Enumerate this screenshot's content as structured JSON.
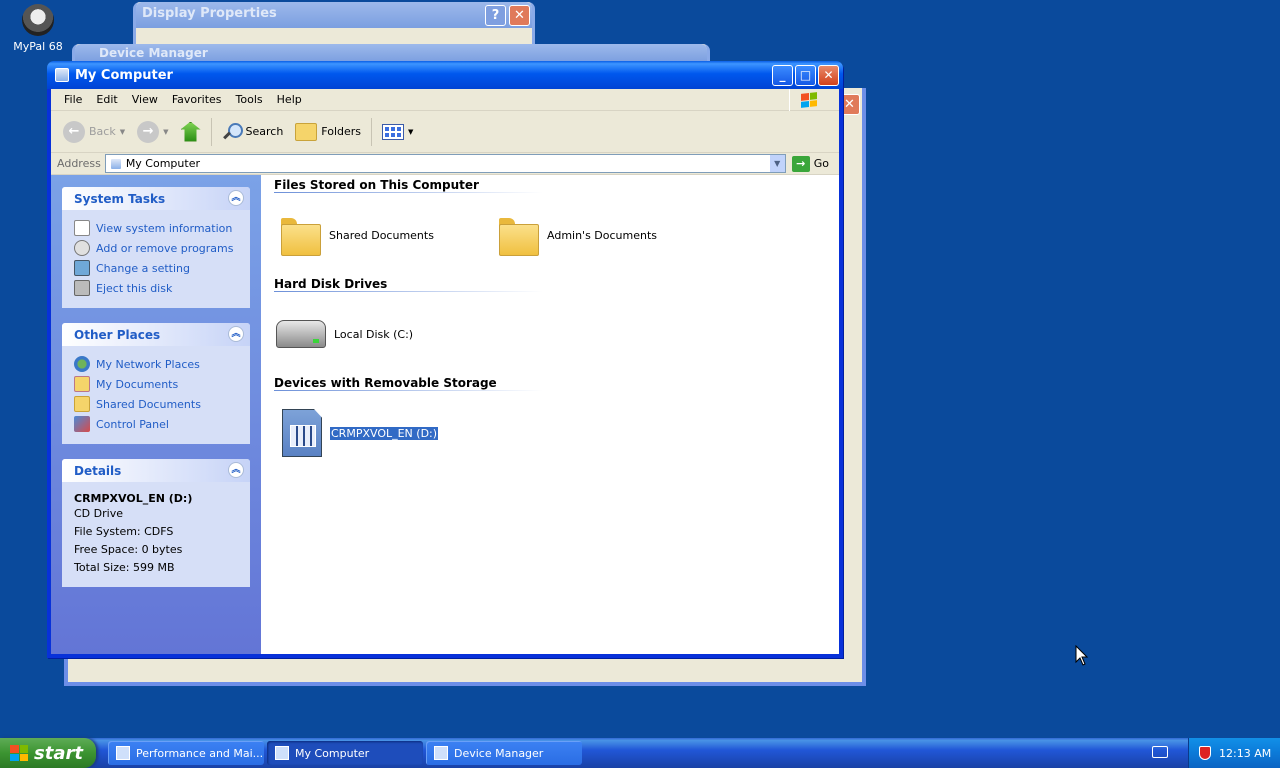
{
  "desktop": {
    "icons": [
      {
        "label": "MyPal 68"
      }
    ]
  },
  "bg_windows": {
    "display_properties": {
      "title": "Display Properties"
    },
    "device_manager": {
      "title": "Device Manager"
    }
  },
  "window": {
    "title": "My Computer",
    "menu": [
      "File",
      "Edit",
      "View",
      "Favorites",
      "Tools",
      "Help"
    ],
    "toolbar": {
      "back": "Back",
      "search": "Search",
      "folders": "Folders"
    },
    "address": {
      "label": "Address",
      "value": "My Computer",
      "go": "Go"
    },
    "left": {
      "system_tasks": {
        "title": "System Tasks",
        "items": [
          "View system information",
          "Add or remove programs",
          "Change a setting",
          "Eject this disk"
        ]
      },
      "other_places": {
        "title": "Other Places",
        "items": [
          "My Network Places",
          "My Documents",
          "Shared Documents",
          "Control Panel"
        ]
      },
      "details": {
        "title": "Details",
        "name": "CRMPXVOL_EN (D:)",
        "type": "CD Drive",
        "file_system": "File System: CDFS",
        "free_space": "Free Space: 0 bytes",
        "total_size": "Total Size: 599 MB"
      }
    },
    "groups": {
      "files": {
        "title": "Files Stored on This Computer",
        "items": [
          "Shared Documents",
          "Admin's Documents"
        ]
      },
      "hdd": {
        "title": "Hard Disk Drives",
        "items": [
          "Local Disk (C:)"
        ]
      },
      "removable": {
        "title": "Devices with Removable Storage",
        "items": [
          "CRMPXVOL_EN (D:)"
        ]
      }
    }
  },
  "taskbar": {
    "start": "start",
    "tasks": [
      "Performance and Mai...",
      "My Computer",
      "Device Manager"
    ],
    "clock": "12:13 AM"
  },
  "colors": {
    "desktop": "#0a4a9c",
    "titlebar": "#0058ee",
    "link": "#215dc6",
    "selection": "#316ac5"
  }
}
